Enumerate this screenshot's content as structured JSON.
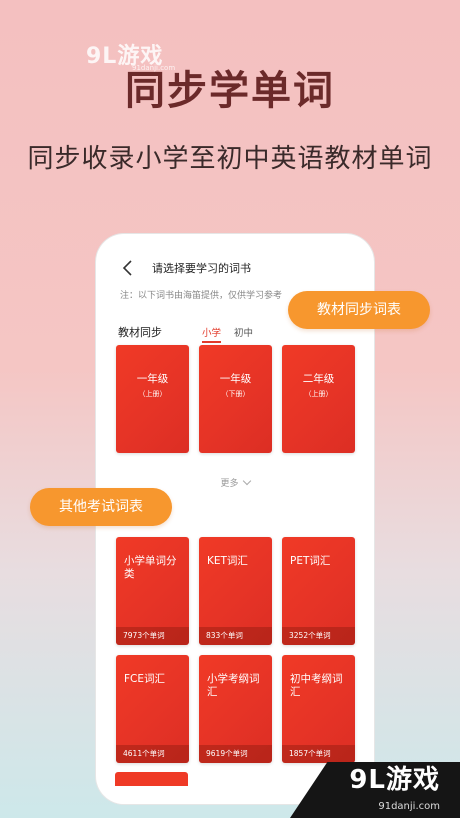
{
  "watermark": {
    "logo_text": "9L游戏",
    "sub_text": "91danji.com"
  },
  "headline": "同步学单词",
  "subheadline": "同步收录小学至初中英语教材单词",
  "screen": {
    "title": "请选择要学习的词书",
    "note": "注：以下词书由海笛提供，仅供学习参考",
    "section_label": "教材同步",
    "tabs": [
      {
        "label": "小学",
        "active": true
      },
      {
        "label": "初中",
        "active": false
      }
    ],
    "grade_cards": [
      {
        "title": "一年级",
        "sub": "（上册）"
      },
      {
        "title": "一年级",
        "sub": "（下册）"
      },
      {
        "title": "二年级",
        "sub": "（上册）"
      }
    ],
    "more_label": "更多",
    "exam_cards": [
      {
        "title": "小学单词分类",
        "count": "7973个单词"
      },
      {
        "title": "KET词汇",
        "count": "833个单词"
      },
      {
        "title": "PET词汇",
        "count": "3252个单词"
      },
      {
        "title": "FCE词汇",
        "count": "4611个单词"
      },
      {
        "title": "小学考纲词汇",
        "count": "9619个单词"
      },
      {
        "title": "初中考纲词汇",
        "count": "1857个单词"
      }
    ]
  },
  "bubbles": {
    "right": "教材同步词表",
    "left": "其他考试词表"
  },
  "corner_badge": {
    "logo": "9L游戏",
    "url": "91danji.com"
  },
  "colors": {
    "accent": "#e23a2a",
    "card_red": "#ec3826",
    "bubble_orange": "#f7972e"
  }
}
